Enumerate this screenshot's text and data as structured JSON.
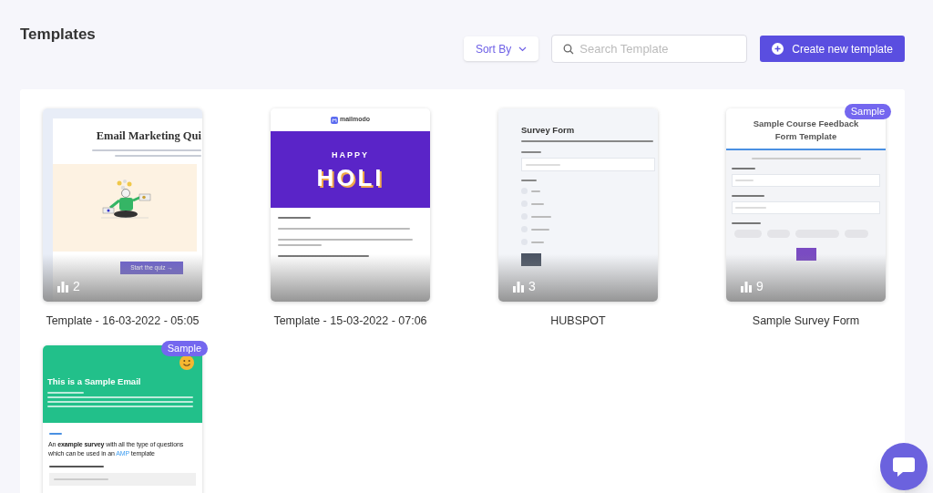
{
  "page_title": "Templates",
  "sort": {
    "label": "Sort By"
  },
  "search": {
    "placeholder": "Search Template"
  },
  "create_button": {
    "label": "Create new template"
  },
  "templates": [
    {
      "name": "Template - 16-03-2022 - 05:05",
      "sample": false,
      "count": "2",
      "preview": {
        "kind": "quiz",
        "title": "Email Marketing Qui",
        "button": "Start the quiz →"
      }
    },
    {
      "name": "Template - 15-03-2022 - 07:06",
      "sample": false,
      "preview": {
        "kind": "email",
        "logo": "mailmodo",
        "banner": [
          "HAPPY",
          "HOLI"
        ]
      }
    },
    {
      "name": "HUBSPOT",
      "sample": false,
      "count": "3",
      "preview": {
        "kind": "form",
        "title": "Survey Form"
      }
    },
    {
      "name": "Sample Survey Form",
      "sample": true,
      "badge": "Sample",
      "count": "9",
      "preview": {
        "kind": "feedback",
        "title": "Sample Course Feedback Form Template"
      }
    },
    {
      "sample": true,
      "badge": "Sample",
      "preview": {
        "kind": "sample-email",
        "title": "This is a Sample Email",
        "sentence": "An **example survey** with all the type of questions which can be used in an",
        "link": "AMP",
        "after": "template"
      }
    }
  ]
}
